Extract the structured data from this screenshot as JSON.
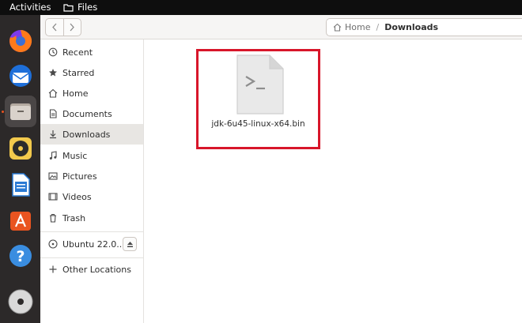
{
  "topbar": {
    "activities": "Activities",
    "app_name": "Files"
  },
  "dock": {
    "items": [
      "firefox-icon",
      "thunderbird-icon",
      "files-icon",
      "rhythmbox-icon",
      "libreoffice-writer-icon",
      "app-center-icon",
      "help-icon",
      "disc-icon"
    ],
    "accent": "#e95420"
  },
  "header": {
    "breadcrumb": {
      "home": "Home",
      "separator": "/",
      "current": "Downloads"
    }
  },
  "sidebar": {
    "items": [
      {
        "label": "Recent",
        "icon": "clock-icon"
      },
      {
        "label": "Starred",
        "icon": "star-icon"
      },
      {
        "label": "Home",
        "icon": "home-icon"
      },
      {
        "label": "Documents",
        "icon": "document-icon"
      },
      {
        "label": "Downloads",
        "icon": "download-icon",
        "selected": true
      },
      {
        "label": "Music",
        "icon": "music-icon"
      },
      {
        "label": "Pictures",
        "icon": "picture-icon"
      },
      {
        "label": "Videos",
        "icon": "video-icon"
      },
      {
        "label": "Trash",
        "icon": "trash-icon"
      }
    ],
    "volume": {
      "label": "Ubuntu 22.0...",
      "icon": "disk-icon"
    },
    "other_locations": "Other Locations"
  },
  "main": {
    "files": [
      {
        "name": "jdk-6u45-linux-x64.bin",
        "icon": "terminal-script-icon",
        "highlighted": true
      }
    ],
    "highlight_color": "#d8162a"
  }
}
